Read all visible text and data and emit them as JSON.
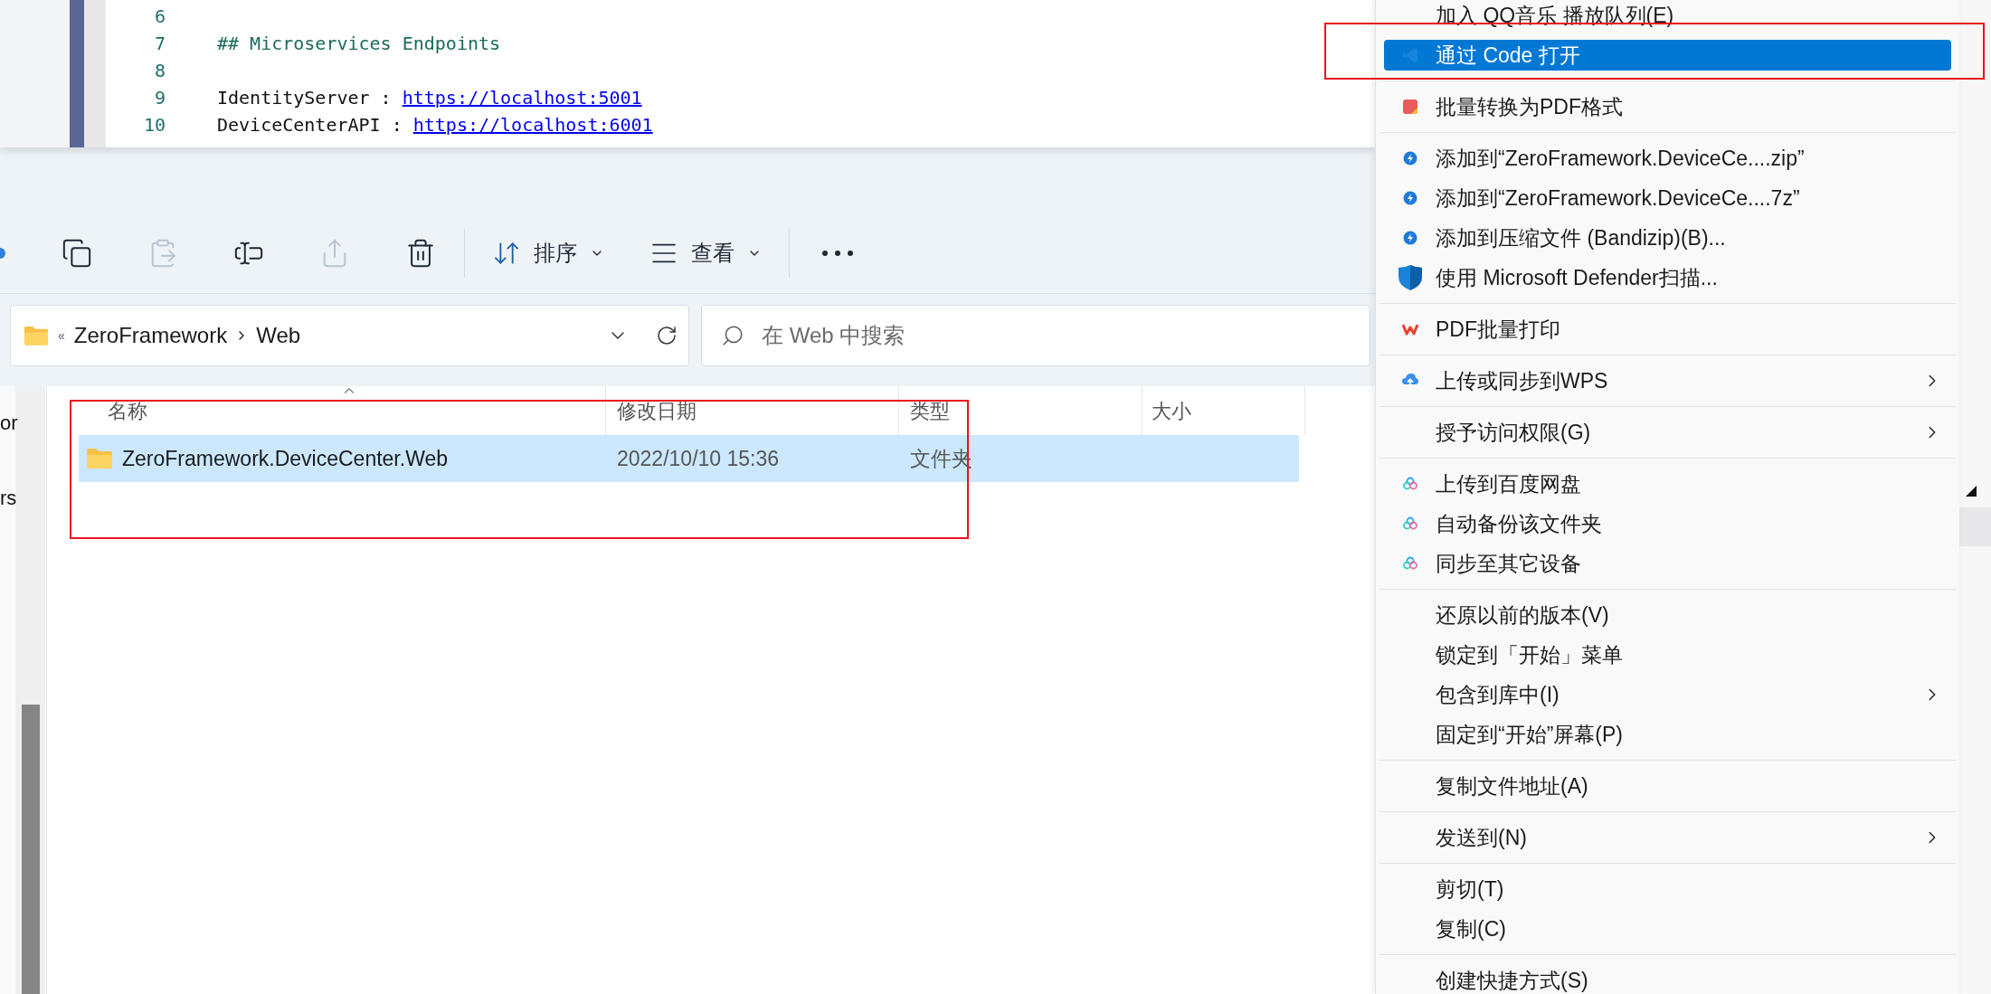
{
  "editor": {
    "lines": [
      {
        "number": "6",
        "kind": "blank"
      },
      {
        "number": "7",
        "kind": "heading",
        "text": "## Microservices Endpoints"
      },
      {
        "number": "8",
        "kind": "blank"
      },
      {
        "number": "9",
        "kind": "link",
        "text": "IdentityServer : ",
        "link": "https://localhost:5001"
      },
      {
        "number": "10",
        "kind": "link",
        "text": "DeviceCenterAPI : ",
        "link": "https://localhost:6001"
      }
    ]
  },
  "toolbar": {
    "buttons": [
      {
        "kind": "partial",
        "disabled": false
      },
      {
        "kind": "copy",
        "disabled": false
      },
      {
        "kind": "paste",
        "disabled": true
      },
      {
        "kind": "rename",
        "disabled": false
      },
      {
        "kind": "share",
        "disabled": true
      },
      {
        "kind": "delete",
        "disabled": false
      }
    ],
    "sort": {
      "label": "排序"
    },
    "view": {
      "label": "查看"
    }
  },
  "address_bar": {
    "overflow": "«",
    "path": [
      "ZeroFramework",
      "Web"
    ]
  },
  "search": {
    "placeholder": "在 Web 中搜索"
  },
  "nav_pane": {
    "items": [
      "or",
      "rs"
    ]
  },
  "table": {
    "columns": [
      "名称",
      "修改日期",
      "类型",
      "大小"
    ],
    "rows": [
      {
        "name": "ZeroFramework.DeviceCenter.Web",
        "modified": "2022/10/10 15:36",
        "type": "文件夹",
        "selected": true
      }
    ]
  },
  "context_menu": {
    "groups": [
      [
        {
          "label": "加入 QQ音乐 播放队列(E)",
          "kind": "plain",
          "submenu": false,
          "selected": false
        },
        {
          "label": "通过 Code 打开",
          "kind": "editor",
          "submenu": false,
          "selected": true
        }
      ],
      [
        {
          "label": "批量转换为PDF格式",
          "kind": "pdf",
          "submenu": false,
          "selected": false
        }
      ],
      [
        {
          "label": "添加到“ZeroFramework.DeviceCe....zip”",
          "kind": "archive",
          "submenu": false,
          "selected": false
        },
        {
          "label": "添加到“ZeroFramework.DeviceCe....7z”",
          "kind": "archive",
          "submenu": false,
          "selected": false
        },
        {
          "label": "添加到压缩文件 (Bandizip)(B)...",
          "kind": "archive",
          "submenu": false,
          "selected": false
        },
        {
          "label": "使用 Microsoft Defender扫描...",
          "kind": "scan",
          "submenu": false,
          "selected": false
        }
      ],
      [
        {
          "label": "PDF批量打印",
          "kind": "print",
          "submenu": false,
          "selected": false
        }
      ],
      [
        {
          "label": "上传或同步到WPS",
          "kind": "upload",
          "submenu": true,
          "selected": false
        }
      ],
      [
        {
          "label": "授予访问权限(G)",
          "kind": "plain",
          "submenu": true,
          "selected": false
        }
      ],
      [
        {
          "label": "上传到百度网盘",
          "kind": "backup",
          "submenu": false,
          "selected": false
        },
        {
          "label": "自动备份该文件夹",
          "kind": "backup",
          "submenu": false,
          "selected": false
        },
        {
          "label": "同步至其它设备",
          "kind": "backup",
          "submenu": false,
          "selected": false
        }
      ],
      [
        {
          "label": "还原以前的版本(V)",
          "kind": "plain",
          "submenu": false,
          "selected": false
        },
        {
          "label": "锁定到「开始」菜单",
          "kind": "plain",
          "submenu": false,
          "selected": false
        },
        {
          "label": "包含到库中(I)",
          "kind": "plain",
          "submenu": true,
          "selected": false
        },
        {
          "label": "固定到“开始”屏幕(P)",
          "kind": "plain",
          "submenu": false,
          "selected": false
        }
      ],
      [
        {
          "label": "复制文件地址(A)",
          "kind": "plain",
          "submenu": false,
          "selected": false
        }
      ],
      [
        {
          "label": "发送到(N)",
          "kind": "plain",
          "submenu": true,
          "selected": false
        }
      ],
      [
        {
          "label": "剪切(T)",
          "kind": "plain",
          "submenu": false,
          "selected": false
        },
        {
          "label": "复制(C)",
          "kind": "plain",
          "submenu": false,
          "selected": false
        }
      ],
      [
        {
          "label": "创建快捷方式(S)",
          "kind": "plain",
          "submenu": false,
          "selected": false
        }
      ]
    ]
  }
}
